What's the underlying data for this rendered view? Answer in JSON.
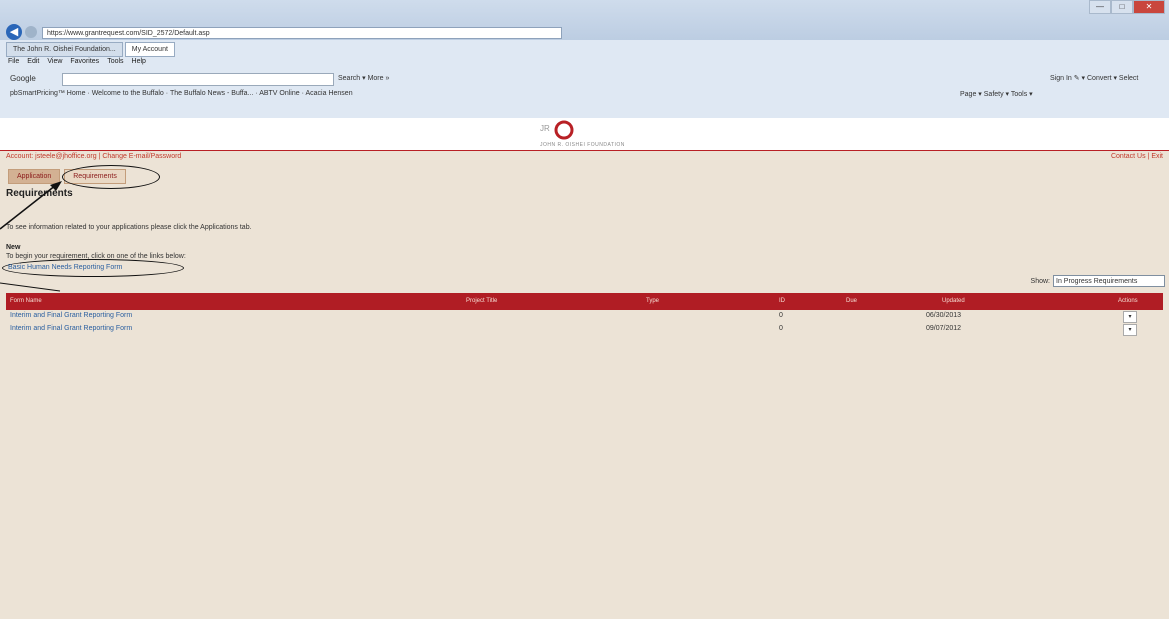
{
  "browser": {
    "address": "https://www.grantrequest.com/SID_2572/Default.asp",
    "address_tools": "",
    "window_controls": [
      "—",
      "□",
      "✕"
    ],
    "tabs": [
      "The John R. Oishei Foundation...",
      "My Account"
    ],
    "menu": [
      "File",
      "Edit",
      "View",
      "Favorites",
      "Tools",
      "Help"
    ],
    "google_label": "Google",
    "google_tools": "Search ▾  More »",
    "sign_in": "Sign In ✎ ▾  Convert ▾  Select",
    "favorites": [
      "pbSmartPricing™ Home",
      "Welcome to the Buffalo",
      "The Buffalo News - Buffa...",
      "ABTV Online",
      "Acacia Hensen"
    ],
    "command_bar": "Page ▾  Safety ▾  Tools ▾"
  },
  "logo": {
    "letters": "JR",
    "name": "JOHN R. OISHEI FOUNDATION"
  },
  "account": {
    "text": "Account: jsteele@jhoffice.org  |  Change E-mail/Password",
    "contact": "Contact Us  |  Exit"
  },
  "page_tabs": [
    "Application",
    "Requirements"
  ],
  "heading": "Requirements",
  "info_text": "To see information related to your applications please click the Applications tab.",
  "new_label": "New",
  "new_text": "To begin your requirement, click on one of the links below:",
  "new_link": "Basic Human Needs Reporting Form",
  "show_label": "Show:",
  "show_value": "In Progress Requirements",
  "table": {
    "headers": [
      "Form Name",
      "Project Title",
      "Type",
      "ID",
      "Due",
      "Updated",
      "Actions"
    ],
    "rows": [
      {
        "name": "Interim and Final Grant Reporting Form",
        "id": "0",
        "updated": "06/30/2013",
        "action": "▾"
      },
      {
        "name": "Interim and Final Grant Reporting Form",
        "id": "0",
        "updated": "09/07/2012",
        "action": "▾"
      }
    ]
  },
  "colors": {
    "brand_red": "#b01d24",
    "page_bg": "#ece3d6",
    "link": "#2a5fa0"
  }
}
